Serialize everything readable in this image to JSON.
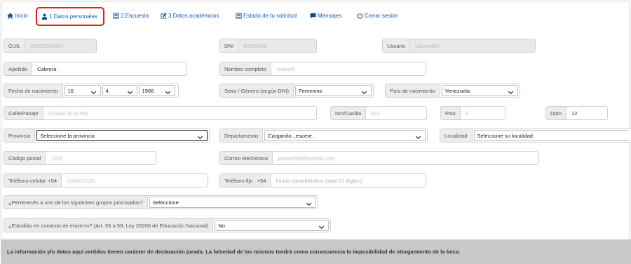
{
  "nav": {
    "inicio": "Inicio",
    "datos": "1.Datos personales",
    "encuesta": "2.Encuesta",
    "academicos": "3.Datos académicos",
    "estado": "Estado de tu solicitud",
    "mensajes": "Mensajes",
    "cerrar": "Cerrar sesión"
  },
  "form": {
    "cuil": {
      "label": "CUIL",
      "value": "23805256484"
    },
    "dni": {
      "label": "DNI",
      "value": "90529848"
    },
    "usuario": {
      "label": "Usuario",
      "value": "cabrera50"
    },
    "apellido": {
      "label": "Apellido",
      "value": "Cabrera"
    },
    "nombre": {
      "label": "Nombre completo",
      "value": "Jeaneth"
    },
    "fecha": {
      "label": "Fecha de nacimiento",
      "day": "16",
      "month": "4",
      "year": "1968"
    },
    "sexo": {
      "label": "Sexo / Género (según DNI)",
      "value": "Femenino"
    },
    "pais": {
      "label": "País de nacimiento",
      "value": "Venezuela"
    },
    "calle": {
      "label": "Calle/Pasaje",
      "value": "Ciudad de la Paz"
    },
    "nro": {
      "label": "Nro/Casilla",
      "value": "651"
    },
    "piso": {
      "label": "Piso",
      "value": "3"
    },
    "dpto": {
      "label": "Dpto",
      "value": "12"
    },
    "provincia": {
      "label": "Provincia",
      "value": "Seleccione la provincia"
    },
    "departamento": {
      "label": "Departamento",
      "value": "Cargando...espere."
    },
    "localidad": {
      "label": "Localidad",
      "value": "Seleccione su localidad."
    },
    "cp": {
      "label": "Código postal",
      "value": "1325"
    },
    "correo": {
      "label": "Correo electrónico",
      "value": "jeaneth58@hotmail.com"
    },
    "celular": {
      "label": "Teléfono celular",
      "prefix": "+54",
      "value": "1165071101"
    },
    "fijo": {
      "label": "Teléfono fijo",
      "prefix": "+54",
      "placeholder": "Incluir característica (total 10 dígitos)"
    },
    "grupos": {
      "label": "¿Pertenecés a uno de los siguientes grupos priorizados?",
      "value": "Seleccione"
    },
    "encierro": {
      "label": "¿Estudiás en contexto de encierro? (Art. 55 a 59, Ley 26206 de Educación Nacional)",
      "value": "No"
    }
  },
  "footer": "La información y/o datos aquí vertidos tienen carácter de declaración jurada. La falsedad de los mismos tendrá como consecuencia la imposibilidad de otorgamiento de la beca."
}
